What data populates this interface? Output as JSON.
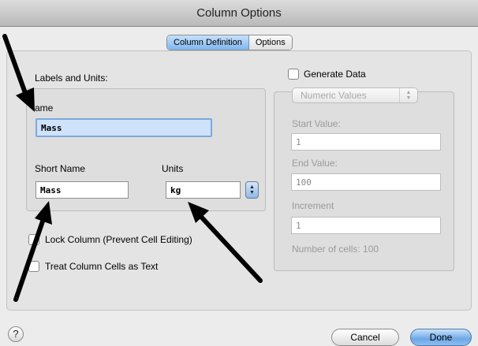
{
  "window": {
    "title": "Column Options"
  },
  "tabs": [
    {
      "label": "Column Definition",
      "active": true
    },
    {
      "label": "Options",
      "active": false
    }
  ],
  "labels_units": {
    "heading": "Labels and Units:",
    "name_label": "ame",
    "name_value": "Mass",
    "short_name_label": "Short Name",
    "short_name_value": "Mass",
    "units_label": "Units",
    "units_value": "kg"
  },
  "options": {
    "lock_column": {
      "label": "Lock Column (Prevent Cell Editing)",
      "checked": false
    },
    "treat_as_text": {
      "label": "Treat Column Cells as Text",
      "checked": false
    }
  },
  "generate": {
    "label": "Generate Data",
    "checked": false,
    "mode": "Numeric Values",
    "start_label": "Start Value:",
    "start_value": "1",
    "end_label": "End Value:",
    "end_value": "100",
    "increment_label": "Increment",
    "increment_value": "1",
    "cells_text": "Number of cells: 100"
  },
  "footer": {
    "help": "?",
    "cancel": "Cancel",
    "done": "Done"
  },
  "colors": {
    "accent": "#7fb5ee",
    "arrow": "#000000"
  }
}
